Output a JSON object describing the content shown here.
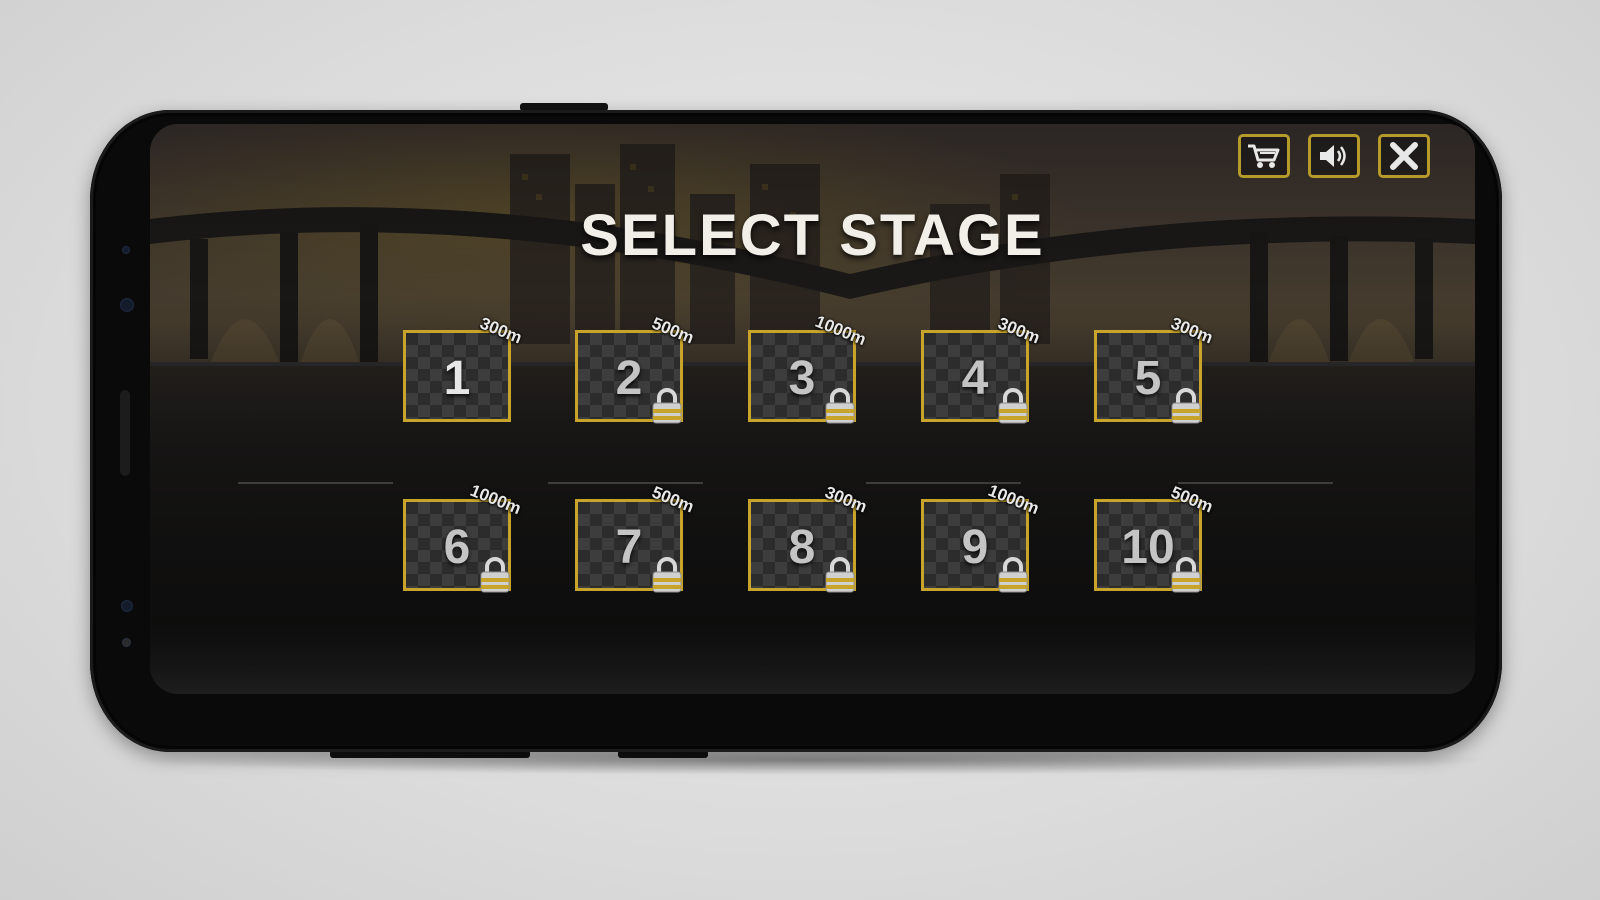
{
  "title": "SELECT STAGE",
  "top_buttons": [
    {
      "icon": "cart-icon"
    },
    {
      "icon": "speaker-icon"
    },
    {
      "icon": "close-icon"
    }
  ],
  "stages": [
    {
      "number": "1",
      "distance": "300m",
      "locked": false
    },
    {
      "number": "2",
      "distance": "500m",
      "locked": true
    },
    {
      "number": "3",
      "distance": "1000m",
      "locked": true
    },
    {
      "number": "4",
      "distance": "300m",
      "locked": true
    },
    {
      "number": "5",
      "distance": "300m",
      "locked": true
    },
    {
      "number": "6",
      "distance": "1000m",
      "locked": true
    },
    {
      "number": "7",
      "distance": "500m",
      "locked": true
    },
    {
      "number": "8",
      "distance": "300m",
      "locked": true
    },
    {
      "number": "9",
      "distance": "1000m",
      "locked": true
    },
    {
      "number": "10",
      "distance": "500m",
      "locked": true
    }
  ],
  "colors": {
    "accent": "#c8a52a",
    "title": "#f2efe8"
  }
}
